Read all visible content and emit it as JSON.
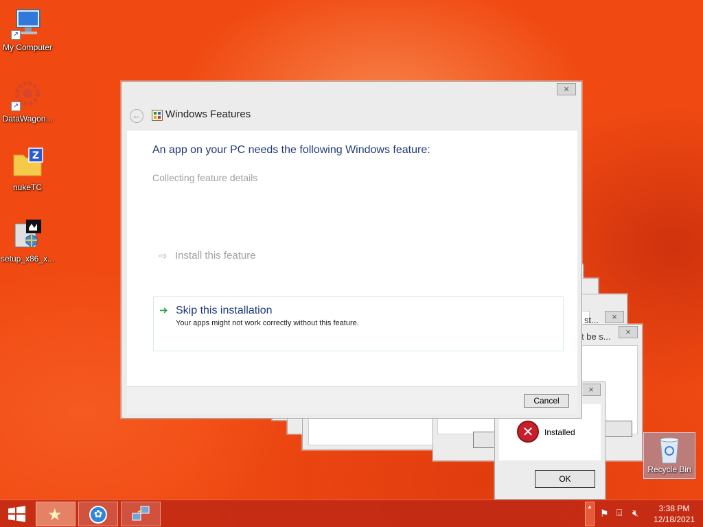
{
  "desktop": {
    "icons": [
      {
        "label": "My Computer",
        "icon": "computer-icon"
      },
      {
        "label": "DataWagon...",
        "icon": "gear-icon"
      },
      {
        "label": "nukeTC",
        "icon": "folder-icon"
      },
      {
        "label": "setup_x86_x...",
        "icon": "installer-icon"
      },
      {
        "label": "Recycle Bin",
        "icon": "recycle-bin-icon"
      }
    ]
  },
  "dialog": {
    "title": "Windows Features",
    "heading": "An app on your PC needs the following Windows feature:",
    "status": "Collecting feature details",
    "option_install": "Install this feature",
    "option_skip": "Skip this installation",
    "option_skip_desc": "Your apps might not work correctly without this feature.",
    "cancel": "Cancel"
  },
  "background_windows": {
    "snippet_1": "st...",
    "snippet_2": "t be s...",
    "close": "×"
  },
  "error_box": {
    "message": "Installed",
    "ok": "OK"
  },
  "taskbar": {
    "time": "3:38 PM",
    "date": "12/18/2021"
  },
  "colors": {
    "accent": "#f04a12",
    "heading": "#1e3a78",
    "status_gray": "#a0a0a0",
    "green_arrow": "#2ea84a",
    "error_red": "#c8202a"
  }
}
